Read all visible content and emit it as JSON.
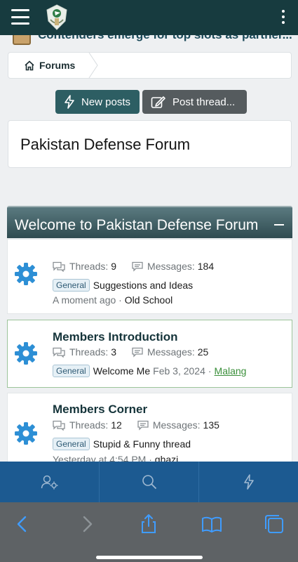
{
  "ticker": {
    "text": "Contenders emerge for top slots as partner..."
  },
  "breadcrumb": {
    "label": "Forums"
  },
  "actions": {
    "new_posts": "New posts",
    "post_thread": "Post thread..."
  },
  "page_title": "Pakistan Defense Forum",
  "section": {
    "title": "Welcome to Pakistan Defense Forum"
  },
  "forums": [
    {
      "title": "",
      "threads_label": "Threads:",
      "threads": "9",
      "messages_label": "Messages:",
      "messages": "184",
      "tag": "General",
      "latest_title": "Suggestions and Ideas",
      "latest_date": "A moment ago",
      "latest_user": "Old School"
    },
    {
      "title": "Members Introduction",
      "threads_label": "Threads:",
      "threads": "3",
      "messages_label": "Messages:",
      "messages": "25",
      "tag": "General",
      "latest_title": "Welcome Me",
      "latest_date": "Feb 3, 2024",
      "latest_user": "Malang"
    },
    {
      "title": "Members Corner",
      "threads_label": "Threads:",
      "threads": "12",
      "messages_label": "Messages:",
      "messages": "135",
      "tag": "General",
      "latest_title": "Stupid & Funny thread",
      "latest_date": "Yesterday at 4:54 PM",
      "latest_user": "ghazi"
    }
  ],
  "colors": {
    "topbar": "#173b3f",
    "accent": "#2d5e63",
    "nav": "#1c5a91",
    "link_visited": "#3a8f3a"
  },
  "icons": [
    "menu-icon",
    "logo-emblem",
    "more-vertical-icon",
    "home-icon",
    "bolt-icon",
    "edit-icon",
    "gear-icon",
    "user-settings-icon",
    "search-icon",
    "back-icon",
    "forward-icon",
    "share-icon",
    "bookmarks-icon",
    "tabs-icon"
  ]
}
